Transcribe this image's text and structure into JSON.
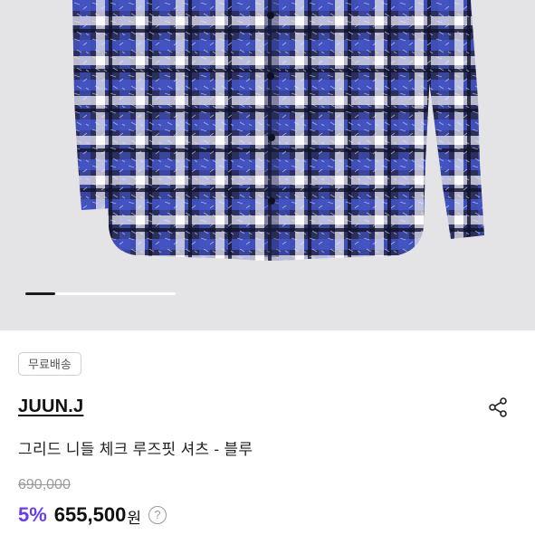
{
  "product": {
    "shipping_badge": "무료배송",
    "brand": "JUUN.J",
    "name": "그리드 니들 체크 루즈핏 셔츠 - 블루",
    "original_price": "690,000",
    "discount_rate": "5%",
    "sale_price": "655,500",
    "currency": "원",
    "help_icon_glyph": "?"
  },
  "carousel": {
    "current_progress": 0.2
  },
  "colors": {
    "discount": "#6a3cf0",
    "image_background": "#e4e4e7",
    "plaid_dark": "#1f2340",
    "plaid_blue": "#3f4fc2",
    "plaid_light": "#d8d8e6"
  },
  "icons": {
    "share": "share-icon",
    "help": "question-circle-icon"
  }
}
